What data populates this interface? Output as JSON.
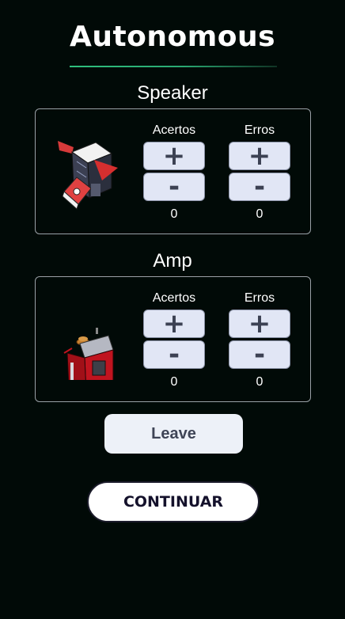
{
  "page": {
    "title": "Autonomous"
  },
  "sections": [
    {
      "title": "Speaker",
      "robot_image": "speaker-robot-image",
      "columns": [
        {
          "label": "Acertos",
          "plus": "+",
          "minus": "-",
          "count": "0"
        },
        {
          "label": "Erros",
          "plus": "+",
          "minus": "-",
          "count": "0"
        }
      ]
    },
    {
      "title": "Amp",
      "robot_image": "amp-robot-image",
      "columns": [
        {
          "label": "Acertos",
          "plus": "+",
          "minus": "-",
          "count": "0"
        },
        {
          "label": "Erros",
          "plus": "+",
          "minus": "-",
          "count": "0"
        }
      ]
    }
  ],
  "buttons": {
    "leave": "Leave",
    "continuar": "CONTINUAR"
  },
  "colors": {
    "background": "#010a07",
    "accent_line": "#2fbf7d",
    "counter_button": "#e1e6f5",
    "counter_text": "#3c4153"
  }
}
